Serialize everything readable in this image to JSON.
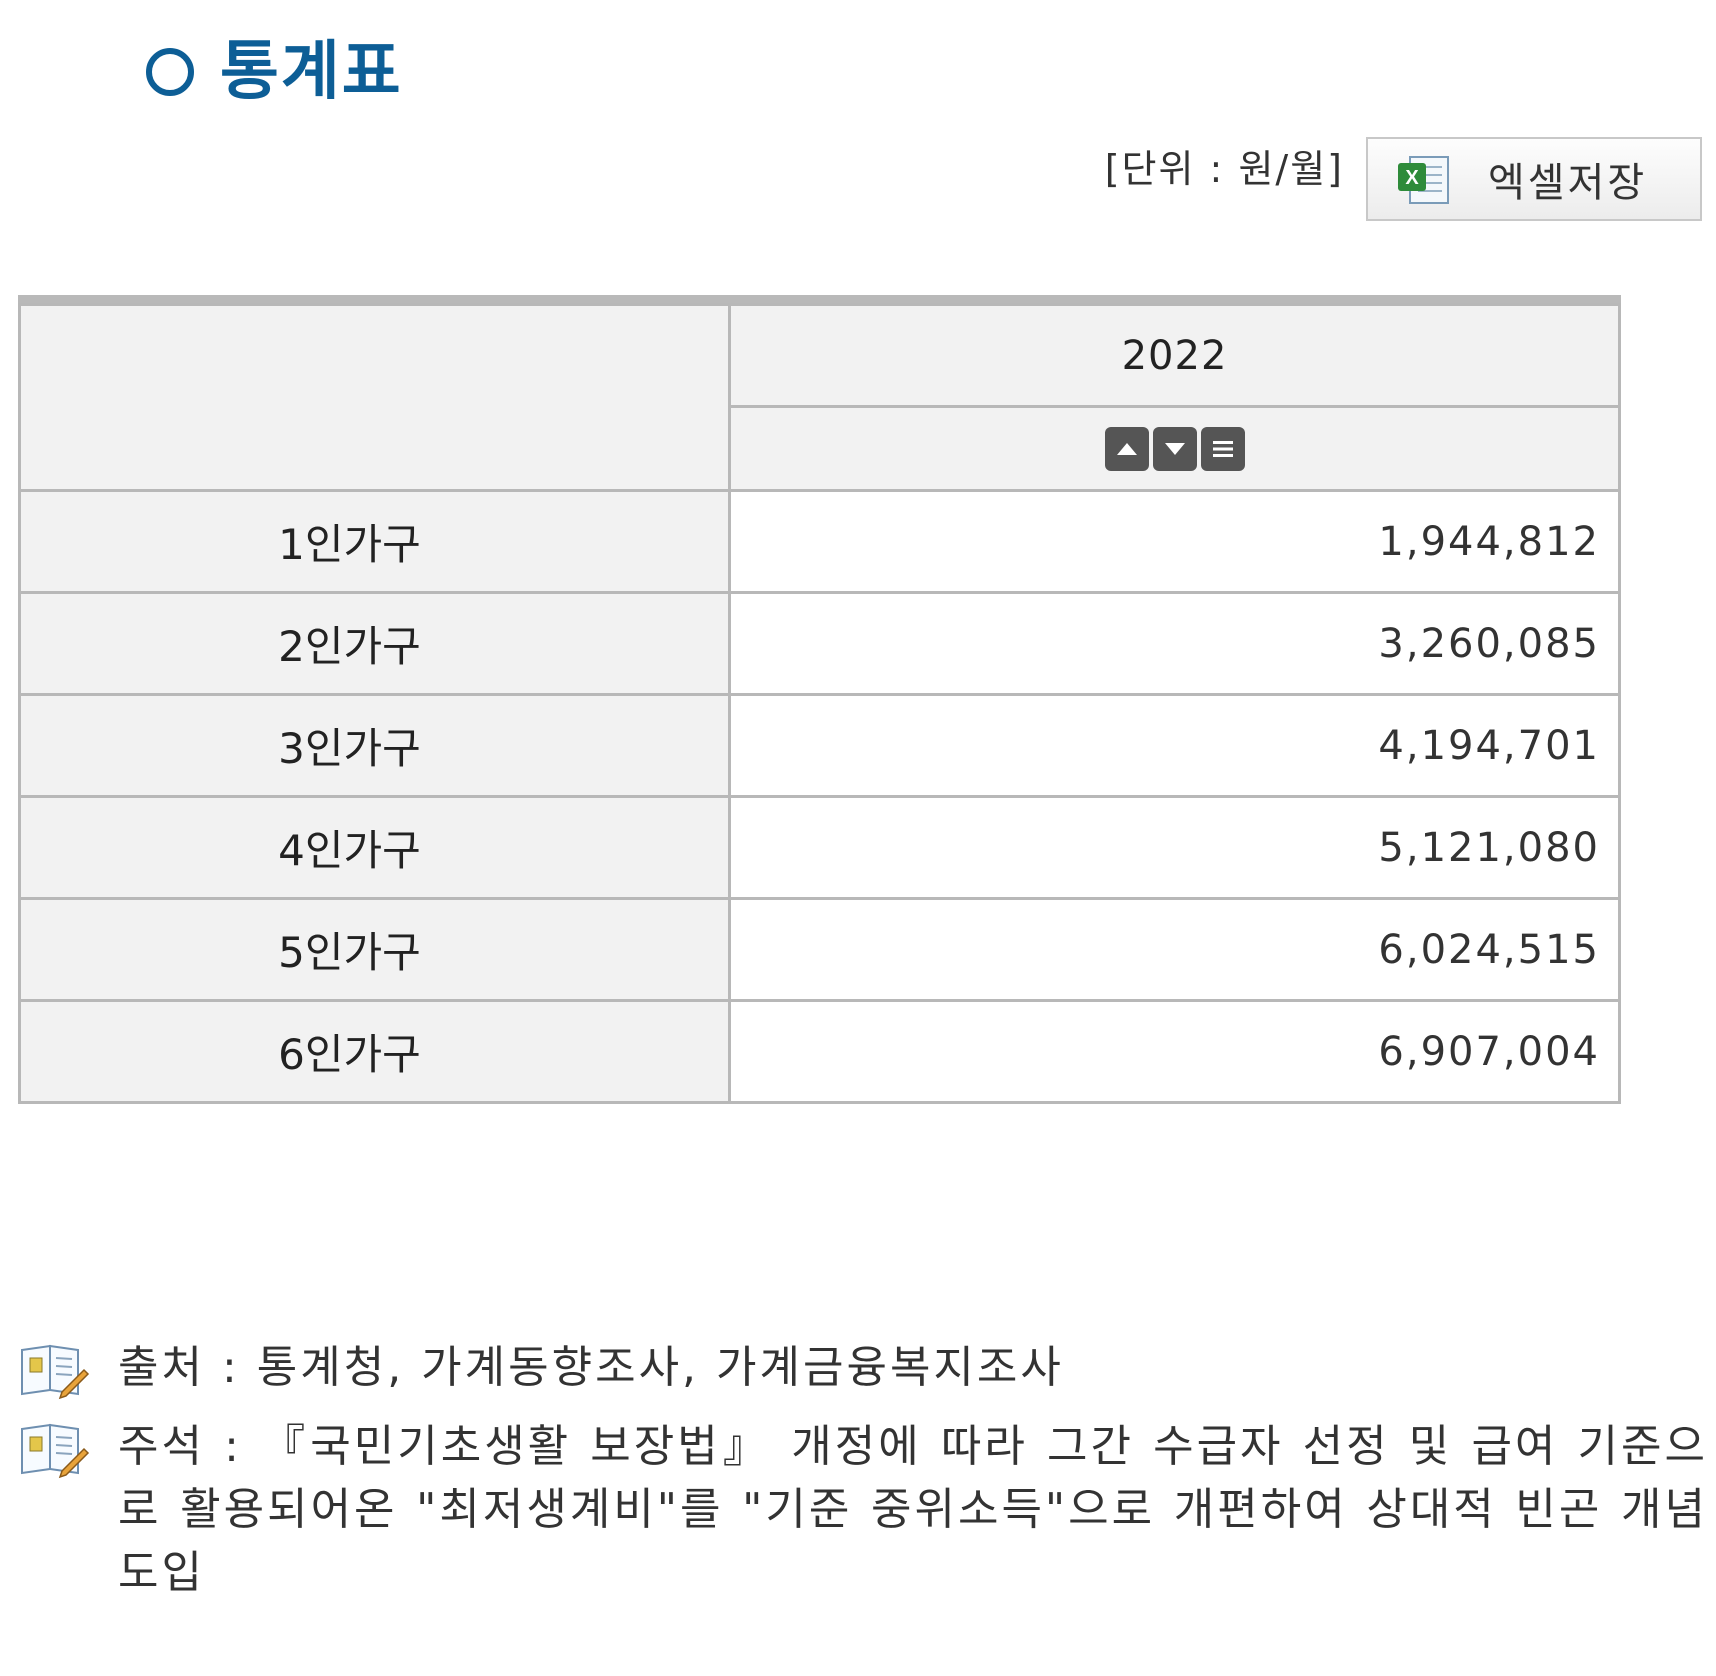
{
  "header": {
    "title": "통계표",
    "unit": "[단위 : 원/월]",
    "excel_button_label": "엑셀저장"
  },
  "table": {
    "year_header": "2022",
    "rows": [
      {
        "label": "1인가구",
        "value": "1,944,812"
      },
      {
        "label": "2인가구",
        "value": "3,260,085"
      },
      {
        "label": "3인가구",
        "value": "4,194,701"
      },
      {
        "label": "4인가구",
        "value": "5,121,080"
      },
      {
        "label": "5인가구",
        "value": "6,024,515"
      },
      {
        "label": "6인가구",
        "value": "6,907,004"
      }
    ]
  },
  "notes": {
    "source": "출처 : 통계청, 가계동향조사, 가계금융복지조사",
    "footnote": "주석 : 『국민기초생활 보장법』 개정에 따라 그간 수급자 선정 및 급여 기준으로 활용되어온 \"최저생계비\"를 \"기준 중위소득\"으로 개편하여 상대적 빈곤 개념 도입"
  },
  "colors": {
    "title": "#0d5e96",
    "header_bg": "#f2f2f2",
    "border": "#b8b8b8",
    "sort_button": "#555555",
    "excel_green": "#2e8b3a"
  },
  "icons": {
    "title": "circle-icon",
    "excel": "excel-icon",
    "sort": [
      "sort-ascending-icon",
      "sort-descending-icon",
      "sort-menu-icon"
    ],
    "note": "book-pencil-icon"
  }
}
